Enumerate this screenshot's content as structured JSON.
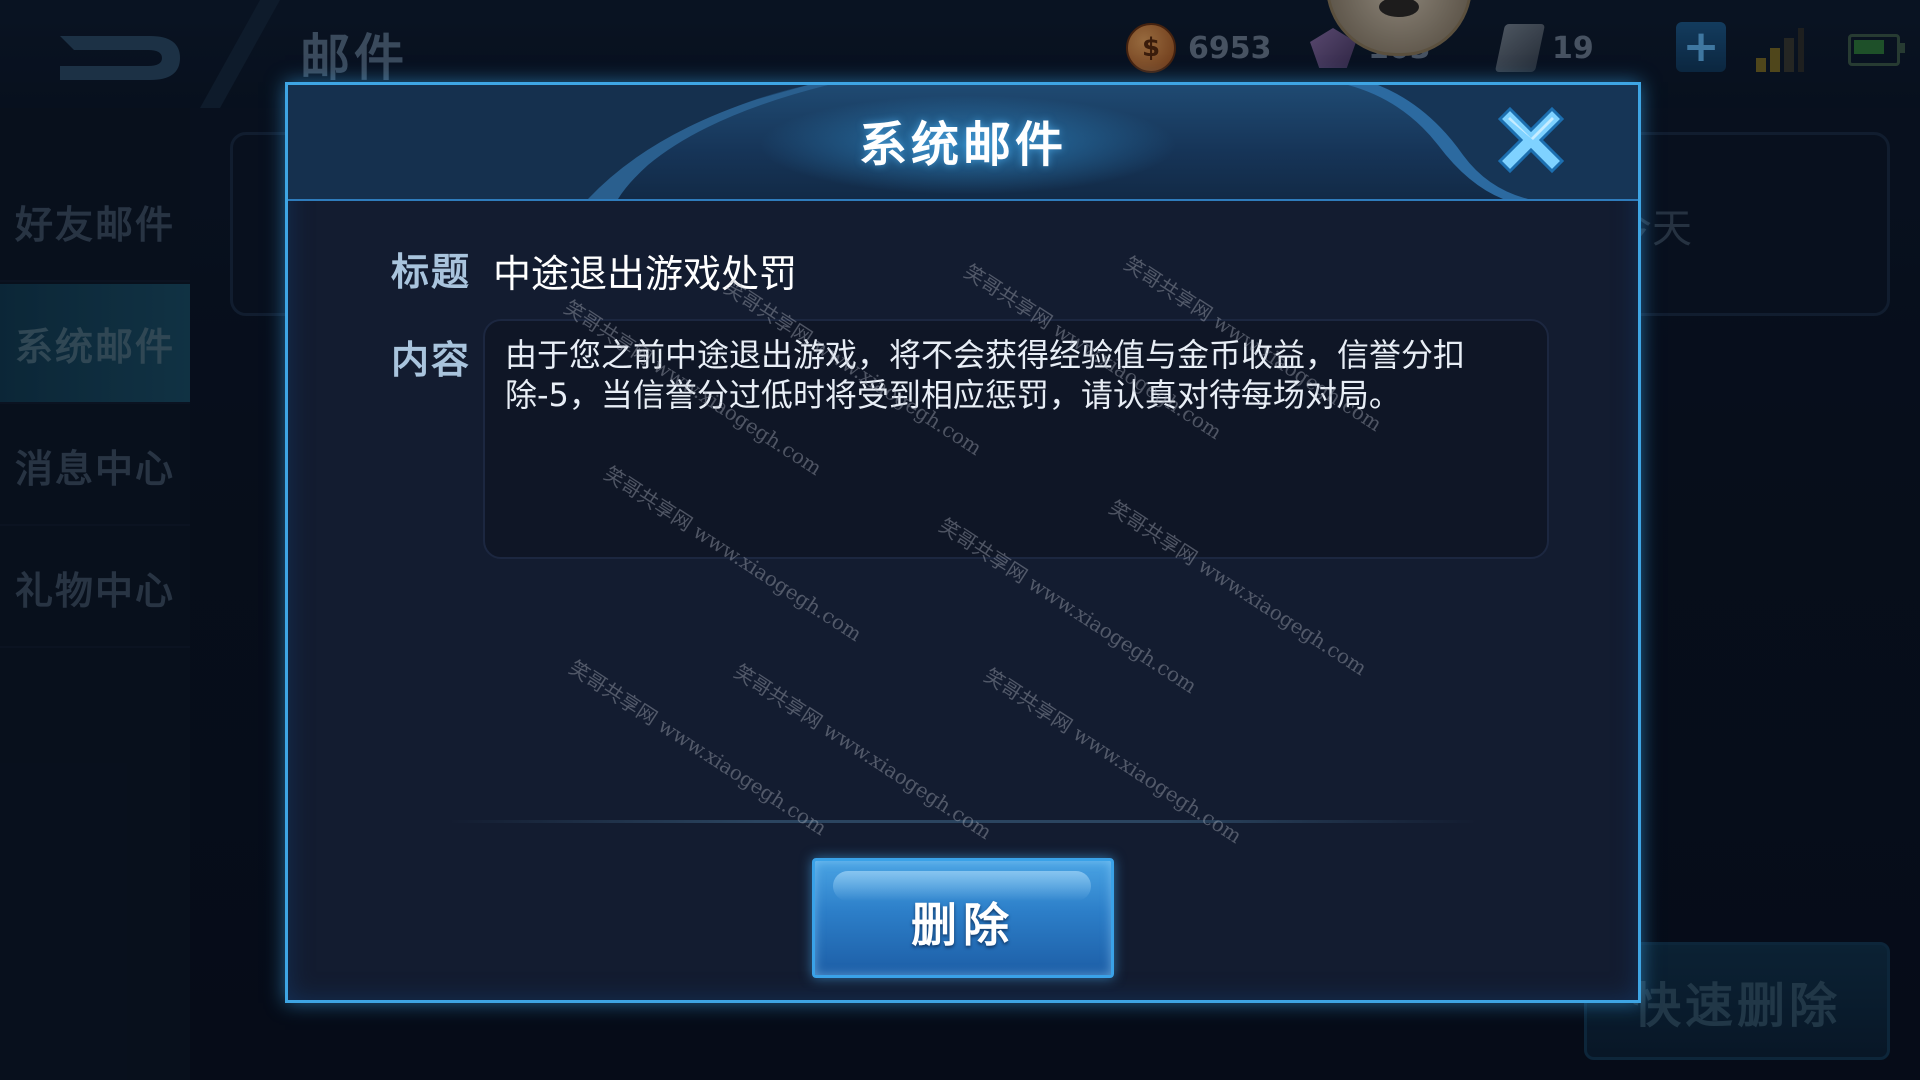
{
  "background": {
    "page_title": "邮件",
    "resources": {
      "coins": "6953",
      "gems": "103",
      "tickets": "19"
    },
    "sidebar": {
      "items": [
        {
          "label": "好友邮件",
          "active": false
        },
        {
          "label": "系统邮件",
          "active": true
        },
        {
          "label": "消息中心",
          "active": false
        },
        {
          "label": "礼物中心",
          "active": false
        }
      ]
    },
    "mail_list": {
      "first_item_date": "今天"
    },
    "quick_delete_label": "快速删除"
  },
  "modal": {
    "title": "系统邮件",
    "subject_label": "标题",
    "subject_value": "中途退出游戏处罚",
    "content_label": "内容",
    "content_text": "由于您之前中途退出游戏，将不会获得经验值与金币收益，信誉分扣除-5，当信誉分过低时将受到相应惩罚，请认真对待每场对局。",
    "delete_label": "删除"
  },
  "watermark": {
    "text": "笑哥共享网 www.xiaogegh.com"
  },
  "colors": {
    "accent_blue": "#3ea5e4",
    "modal_bg": "#131c30",
    "label_color": "#a9c4dd"
  },
  "icons": {
    "back": "back-arrow-icon",
    "coin": "coin-icon",
    "gem": "gem-icon",
    "ticket": "ticket-icon",
    "close": "close-icon",
    "signal": "signal-icon",
    "battery": "battery-icon"
  }
}
